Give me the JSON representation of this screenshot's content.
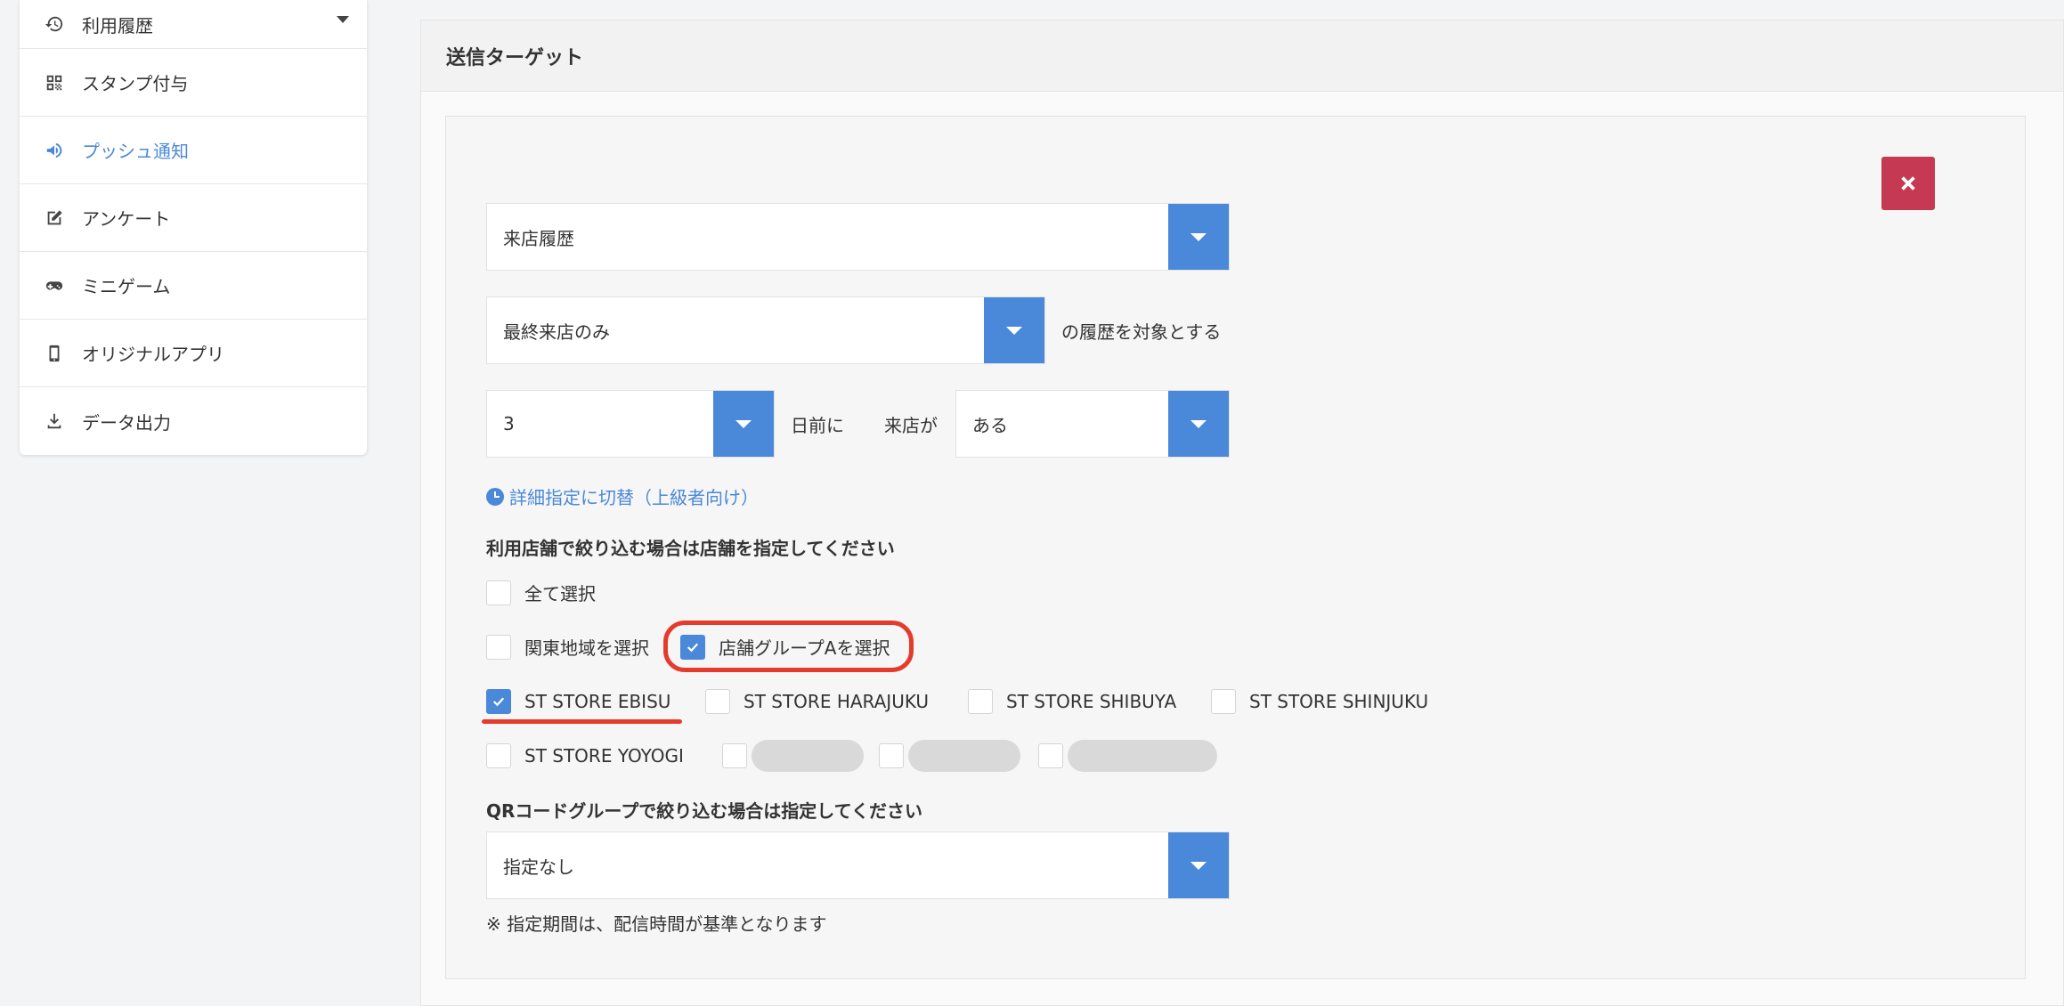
{
  "sidebar": {
    "items": [
      {
        "label": "利用履歴",
        "icon": "history-icon"
      },
      {
        "label": "スタンプ付与",
        "icon": "qr-code-icon"
      },
      {
        "label": "プッシュ通知",
        "icon": "megaphone-icon"
      },
      {
        "label": "アンケート",
        "icon": "edit-icon"
      },
      {
        "label": "ミニゲーム",
        "icon": "gamepad-icon"
      },
      {
        "label": "オリジナルアプリ",
        "icon": "mobile-phone-icon"
      },
      {
        "label": "データ出力",
        "icon": "download-icon"
      }
    ],
    "active_index": 2
  },
  "panel": {
    "title": "送信ターゲット"
  },
  "form": {
    "history_type": "来店履歴",
    "history_scope": "最終来店のみ",
    "history_scope_suffix": "の履歴を対象とする",
    "days": "3",
    "days_suffix": "日前に",
    "visit_label": "来店が",
    "visit_value": "ある",
    "advanced_link": "詳細指定に切替（上級者向け）",
    "store_section_label": "利用店舗で絞り込む場合は店舗を指定してください",
    "select_all": {
      "label": "全て選択",
      "checked": false
    },
    "groups": [
      {
        "label": "関東地域を選択",
        "checked": false
      },
      {
        "label": "店舗グループAを選択",
        "checked": true
      }
    ],
    "stores": [
      {
        "label": "ST STORE EBISU",
        "checked": true
      },
      {
        "label": "ST STORE HARAJUKU",
        "checked": false
      },
      {
        "label": "ST STORE SHIBUYA",
        "checked": false
      },
      {
        "label": "ST STORE SHINJUKU",
        "checked": false
      },
      {
        "label": "ST STORE YOYOGI",
        "checked": false
      }
    ],
    "qr_section_label": "QRコードグループで絞り込む場合は指定してください",
    "qr_group": "指定なし",
    "note": "※ 指定期間は、配信時間が基準となります"
  },
  "colors": {
    "accent": "#4a88d9",
    "close_button": "#c53a52",
    "highlight": "#e53b2c"
  }
}
